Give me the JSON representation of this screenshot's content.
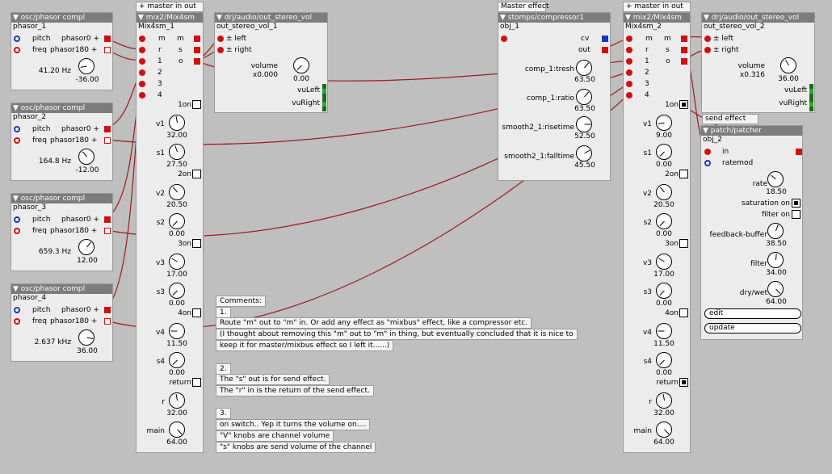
{
  "phasors": [
    {
      "type": "osc/phasor compl",
      "instance": "phasor_1",
      "pitch_label": "pitch",
      "pitch_port": "phasor0",
      "freq_label": "freq",
      "freq_port": "phasor180",
      "value": "41.20 Hz",
      "knob_value": "-36.00"
    },
    {
      "type": "osc/phasor compl",
      "instance": "phasor_2",
      "pitch_label": "pitch",
      "pitch_port": "phasor0",
      "freq_label": "freq",
      "freq_port": "phasor180",
      "value": "164.8 Hz",
      "knob_value": "-12.00"
    },
    {
      "type": "osc/phasor compl",
      "instance": "phasor_3",
      "pitch_label": "pitch",
      "pitch_port": "phasor0",
      "freq_label": "freq",
      "freq_port": "phasor180",
      "value": "659.3 Hz",
      "knob_value": "12.00"
    },
    {
      "type": "osc/phasor compl",
      "instance": "phasor_4",
      "pitch_label": "pitch",
      "pitch_port": "phasor0",
      "freq_label": "freq",
      "freq_port": "phasor180",
      "value": "2.637 kHz",
      "knob_value": "36.00"
    }
  ],
  "mix1": {
    "caption": "+ master in out",
    "type": "mix2/Mix4sm",
    "instance": "Mix4sm_1",
    "ports": {
      "m_in": "m",
      "m_out": "m",
      "r": "r",
      "s": "s",
      "in1": "1",
      "o": "o",
      "in2": "2",
      "in3": "3",
      "in4": "4"
    },
    "controls": {
      "on1": "1on",
      "v1": "v1",
      "v1_value": "32.00",
      "s1": "s1",
      "s1_value": "27.50",
      "on2": "2on",
      "v2": "v2",
      "v2_value": "20.50",
      "s2": "s2",
      "s2_value": "0.00",
      "on3": "3on",
      "v3": "v3",
      "v3_value": "17.00",
      "s3": "s3",
      "s3_value": "0.00",
      "on4": "4on",
      "v4": "v4",
      "v4_value": "11.50",
      "s4": "s4",
      "s4_value": "0.00",
      "return": "return",
      "r": "r",
      "r_value": "32.00",
      "main": "main",
      "main_value": "64.00"
    }
  },
  "mix2": {
    "caption": "+ master in out",
    "type": "mix2/Mix4sm",
    "instance": "Mix4sm_2",
    "ports": {
      "m_in": "m",
      "m_out": "m",
      "r": "r",
      "s": "s",
      "in1": "1",
      "o": "o",
      "in2": "2",
      "in3": "3",
      "in4": "4"
    },
    "controls": {
      "on1": "1on",
      "v1": "v1",
      "v1_value": "9.00",
      "s1": "s1",
      "s1_value": "0.00",
      "on2": "2on",
      "v2": "v2",
      "v2_value": "20.50",
      "s2": "s2",
      "s2_value": "0.00",
      "on3": "3on",
      "v3": "v3",
      "v3_value": "17.00",
      "s3": "s3",
      "s3_value": "0.00",
      "on4": "4on",
      "v4": "v4",
      "v4_value": "11.50",
      "s4": "s4",
      "s4_value": "0.00",
      "return": "return",
      "r": "r",
      "r_value": "32.00",
      "main": "main",
      "main_value": "64.00"
    }
  },
  "out1": {
    "type": "drj/audio/out_stereo_vol",
    "instance": "out_stereo_vol_1",
    "left": "left",
    "right": "right",
    "volume": "volume",
    "volume_db": "x0.000",
    "knob_value": "0.00",
    "vuleft": "vuLeft",
    "vuright": "vuRight"
  },
  "out2": {
    "type": "drj/audio/out_stereo_vol",
    "instance": "out_stereo_vol_2",
    "left": "left",
    "right": "right",
    "volume": "volume",
    "volume_db": "x0.316",
    "knob_value": "36.00",
    "vuleft": "vuLeft",
    "vuright": "vuRight"
  },
  "comp": {
    "caption": "Master effect",
    "type": "stomps/compressor1",
    "instance": "obj_1",
    "cv": "cv",
    "out": "out",
    "tresh": "comp_1:tresh",
    "tresh_value": "63.50",
    "ratio": "comp_1:ratio",
    "ratio_value": "63.50",
    "rise": "smooth2_1:risetime",
    "rise_value": "52.50",
    "fall": "smooth2_1:falltime",
    "fall_value": "45.50"
  },
  "patcher": {
    "caption": "send effect",
    "type": "patch/patcher",
    "instance": "obj_2",
    "in": "in",
    "ratemod": "ratemod",
    "rate": "rate",
    "rate_value": "18.50",
    "saturation": "saturation on",
    "filter_on": "filter on",
    "feedback": "feedback-buffer",
    "feedback_value": "38.50",
    "filter": "filter",
    "filter_value": "34.00",
    "drywet": "dry/wet",
    "drywet_value": "64.00",
    "edit": "edit",
    "update": "update"
  },
  "comments": {
    "title": "Comments:",
    "c1_num": "1.",
    "c1_a": "Route \"m\" out to \"m\" in. Or add any effect as \"mixbus\" effect, like a compressor etc.",
    "c1_b": "(I thought about removing this \"m\" out to \"m\" in thing, but eventually concluded that it is nice to",
    "c1_c": "keep it for master/mixbus effect so I left it......)",
    "c2_num": "2.",
    "c2_a": "The \"s\" out is for send effect.",
    "c2_b": "The \"r\" in is the return of the send effect.",
    "c3_num": "3.",
    "c3_a": "on switch.. Yep it turns the volume on....",
    "c3_b": "\"V\" knobs are channel  volume",
    "c3_c": "\"s\" knobs are send volume of the channel"
  },
  "colors": {
    "canvas": "#bfbfbf",
    "object": "#ececec",
    "header": "#7c7c7c",
    "wire": "#a01818",
    "port_red": "#d01010",
    "port_blue": "#1836b8"
  }
}
